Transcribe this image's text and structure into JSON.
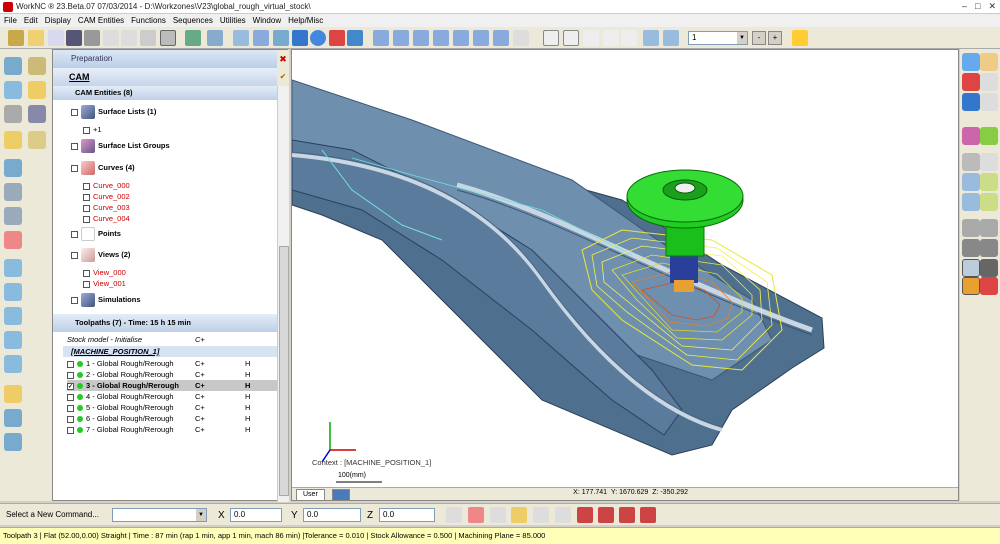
{
  "titlebar": {
    "title": "WorkNC ® 23.Beta.07   07/03/2014 - D:\\Workzones\\V23\\global_rough_virtual_stock\\"
  },
  "menu": [
    "File",
    "Edit",
    "Display",
    "CAM Entities",
    "Functions",
    "Sequences",
    "Utilities",
    "Window",
    "Help/Misc"
  ],
  "toolbar": {
    "selector_value": "1"
  },
  "panel": {
    "title": "Preparation",
    "cam_tab": "CAM",
    "cam_entities": "CAM Entities (8)",
    "surface_lists": "Surface Lists (1)",
    "surface_list_item": "+1",
    "surface_list_groups": "Surface List Groups",
    "curves": "Curves (4)",
    "curve_items": [
      "Curve_000",
      "Curve_002",
      "Curve_003",
      "Curve_004"
    ],
    "points": "Points",
    "views": "Views (2)",
    "view_items": [
      "View_000",
      "View_001"
    ],
    "simulations": "Simulations",
    "toolpaths_header": "Toolpaths (7) - Time: 15 h 15 min",
    "stock_label": "Stock model - Initialise",
    "stock_code": "C+",
    "machine_position": "[MACHINE_POSITION_1]",
    "toolpaths": [
      {
        "label": "1 - Global Rough/Rerough",
        "c": "C+",
        "h": "H",
        "checked": false,
        "selected": false
      },
      {
        "label": "2 - Global Rough/Rerough",
        "c": "C+",
        "h": "H",
        "checked": false,
        "selected": false
      },
      {
        "label": "3 - Global Rough/Rerough",
        "c": "C+",
        "h": "H",
        "checked": true,
        "selected": true
      },
      {
        "label": "4 - Global Rough/Rerough",
        "c": "C+",
        "h": "H",
        "checked": false,
        "selected": false
      },
      {
        "label": "5 - Global Rough/Rerough",
        "c": "C+",
        "h": "H",
        "checked": false,
        "selected": false
      },
      {
        "label": "6 - Global Rough/Rerough",
        "c": "C+",
        "h": "H",
        "checked": false,
        "selected": false
      },
      {
        "label": "7 - Global Rough/Rerough",
        "c": "C+",
        "h": "H",
        "checked": false,
        "selected": false
      }
    ]
  },
  "viewport": {
    "context": "Context : [MACHINE_POSITION_1]",
    "scale": "100(mm)",
    "tab_user": "User",
    "coord_x": "X: 177.741",
    "coord_y": "Y: 1670.629",
    "coord_z": "Z: -350.292"
  },
  "command": {
    "label": "Select a New Command...",
    "x_label": "X",
    "x_value": "0.0",
    "y_label": "Y",
    "y_value": "0.0",
    "z_label": "Z",
    "z_value": "0.0"
  },
  "status": "Toolpath 3 | Flat (52.00,0.00) Straight | Time : 87 min (rap 1 min, app 1 min, mach 86 min) |Tolerance = 0.010 | Stock Allowance = 0.500 | Machining Plane = 85.000"
}
